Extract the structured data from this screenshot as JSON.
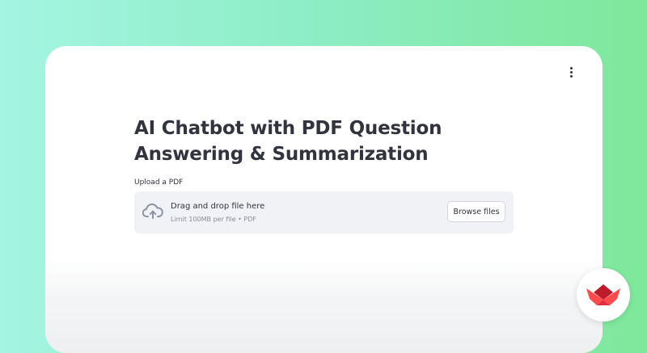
{
  "app": {
    "title": "AI Chatbot with PDF Question Answering & Summarization",
    "menu_icon": "vertical-dots-menu-icon"
  },
  "uploader": {
    "label": "Upload a PDF",
    "drop_text": "Drag and drop file here",
    "limit_text": "Limit 100MB per file • PDF",
    "browse_label": "Browse files",
    "icon": "cloud-upload-icon"
  },
  "branding": {
    "logo": "streamlit-logo-icon",
    "accent": "#ff4b4b"
  }
}
